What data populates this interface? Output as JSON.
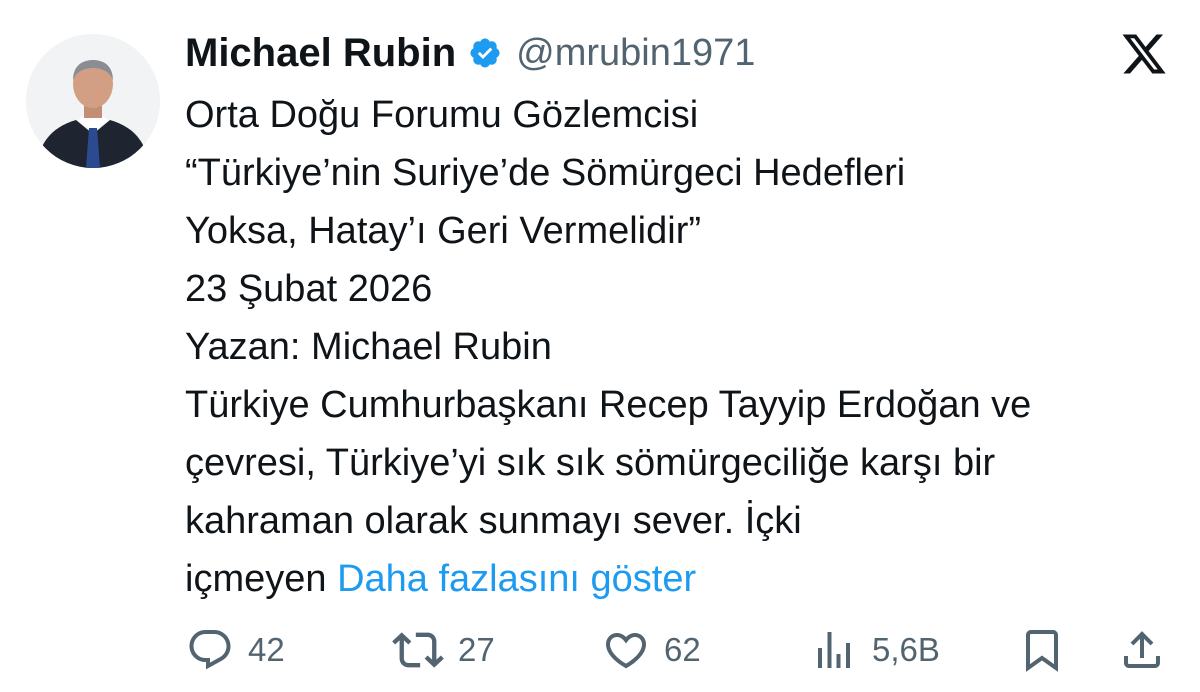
{
  "author": {
    "name": "Michael Rubin",
    "handle": "@mrubin1971"
  },
  "tweet": {
    "lines": [
      "Orta Doğu Forumu Gözlemcisi",
      "“Türkiye’nin Suriye’de Sömürgeci Hedefleri",
      "Yoksa, Hatay’ı Geri Vermelidir”",
      "23 Şubat 2026",
      "Yazan: Michael Rubin",
      "Türkiye Cumhurbaşkanı Recep Tayyip Erdoğan ve",
      "çevresi, Türkiye’yi sık sık sömürgeciliğe karşı bir",
      "kahraman olarak sunmayı sever. İçki"
    ],
    "last_line_start": "içmeyen",
    "show_more": "Daha fazlasını göster"
  },
  "actions": {
    "replies": "42",
    "reposts": "27",
    "likes": "62",
    "views": "5,6B"
  },
  "icons": {
    "brand": "x-logo-icon",
    "verified": "verified-badge-icon",
    "reply": "reply-icon",
    "repost": "repost-icon",
    "like": "heart-icon",
    "views": "views-chart-icon",
    "bookmark": "bookmark-icon",
    "share": "share-icon"
  },
  "colors": {
    "accent": "#1d9bf0",
    "text": "#0f1419",
    "secondary": "#536471"
  }
}
